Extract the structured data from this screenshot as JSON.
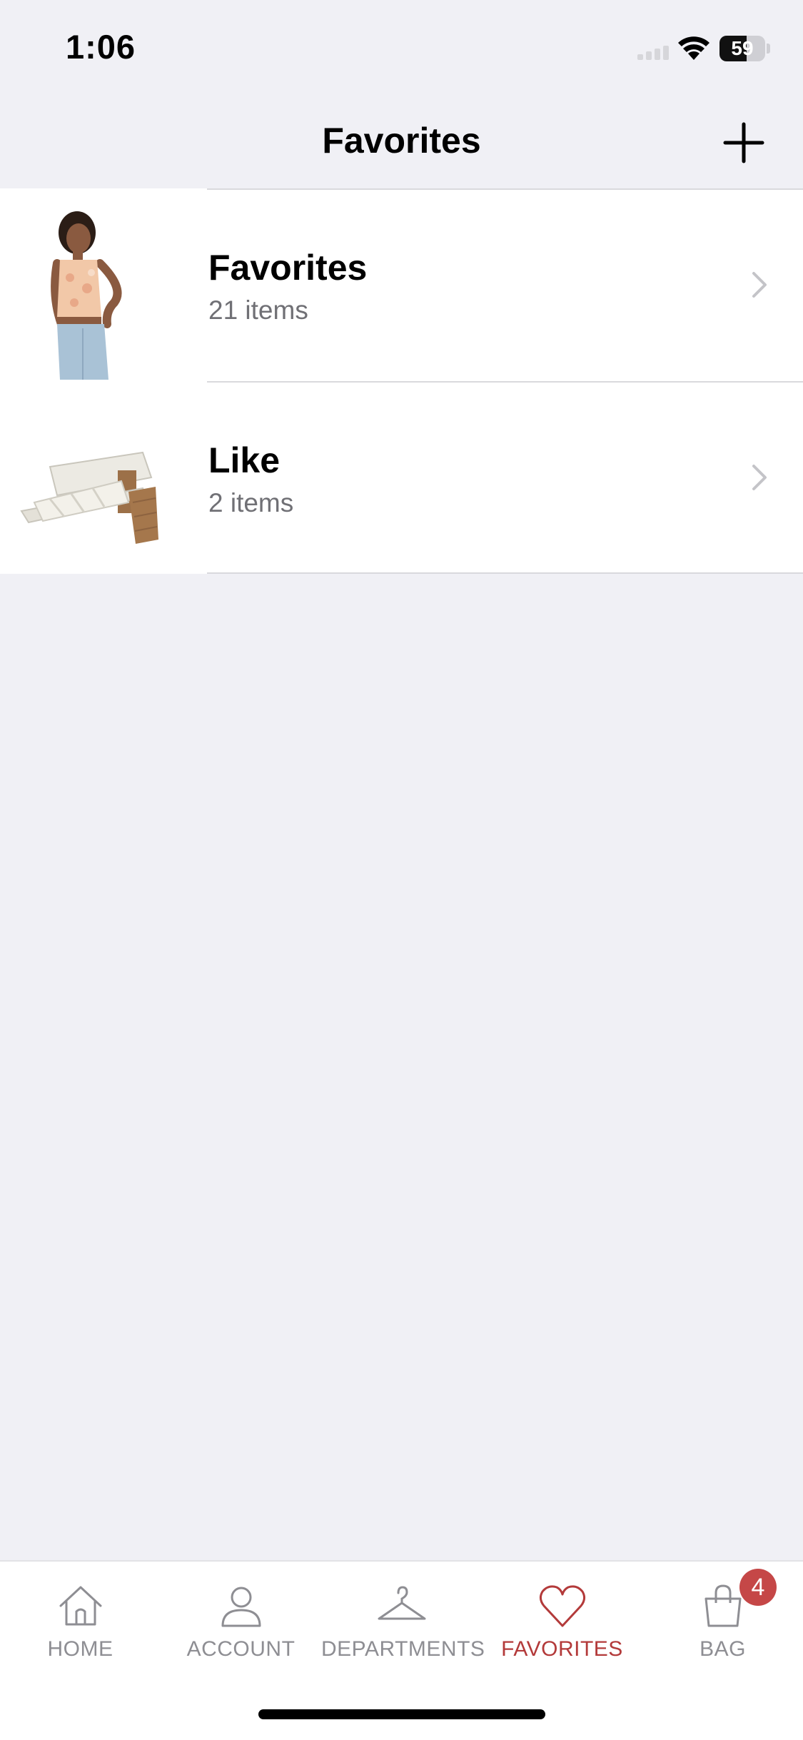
{
  "status_bar": {
    "time": "1:06",
    "battery_percent": "59",
    "battery_level": 0.59
  },
  "nav": {
    "title": "Favorites",
    "add_icon": "plus-icon"
  },
  "lists": [
    {
      "title": "Favorites",
      "count_label": "21 items",
      "thumbnail": "woman-in-floral-tank-top-and-jean-shorts"
    },
    {
      "title": "Like",
      "count_label": "2 items",
      "thumbnail": "white-woven-block-heel-sandals"
    }
  ],
  "tab_bar": {
    "tabs": [
      {
        "label": "HOME",
        "icon": "house-icon"
      },
      {
        "label": "ACCOUNT",
        "icon": "person-icon"
      },
      {
        "label": "DEPARTMENTS",
        "icon": "hanger-icon"
      },
      {
        "label": "FAVORITES",
        "icon": "heart-icon",
        "active": true
      },
      {
        "label": "BAG",
        "icon": "shopping-bag-icon"
      }
    ],
    "bag_badge": "4",
    "active_color": "#b33a3a",
    "inactive_color": "#8e8e93"
  }
}
